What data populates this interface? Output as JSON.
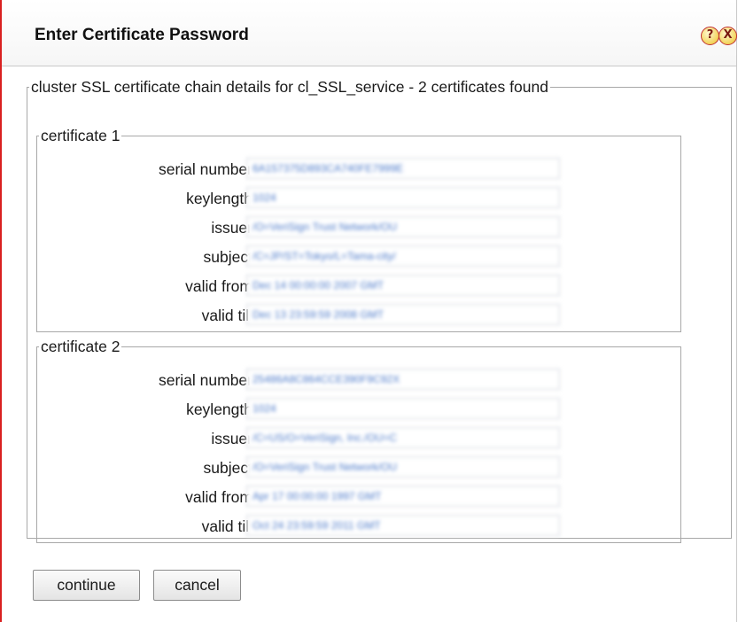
{
  "dialog": {
    "title": "Enter Certificate Password",
    "help_icon": "?",
    "close_icon": "X"
  },
  "chain": {
    "legend": "cluster SSL certificate chain details for cl_SSL_service - 2 certificates found"
  },
  "labels": {
    "serial_number": "serial number",
    "keylength": "keylength",
    "issuer": "issuer",
    "subject": "subject",
    "valid_from": "valid from",
    "valid_till": "valid till"
  },
  "certificates": [
    {
      "legend": "certificate 1",
      "serial_number": "6A157375D893CA740FE7999E",
      "keylength": "1024",
      "issuer": "/O=VeriSign Trust Network/OU",
      "subject": "/C=JP/ST=Tokyo/L=Tama-city/",
      "valid_from": "Dec 14 00:00:00 2007 GMT",
      "valid_till": "Dec 13 23:59:59 2008 GMT"
    },
    {
      "legend": "certificate 2",
      "serial_number": "25486A8C864CCE390F9C92X",
      "keylength": "1024",
      "issuer": "/C=US/O=VeriSign, Inc./OU=C",
      "subject": "/O=VeriSign Trust Network/OU",
      "valid_from": "Apr 17 00:00:00 1997 GMT",
      "valid_till": "Oct 24 23:59:59 2011 GMT"
    }
  ],
  "buttons": {
    "continue": "continue",
    "cancel": "cancel"
  }
}
